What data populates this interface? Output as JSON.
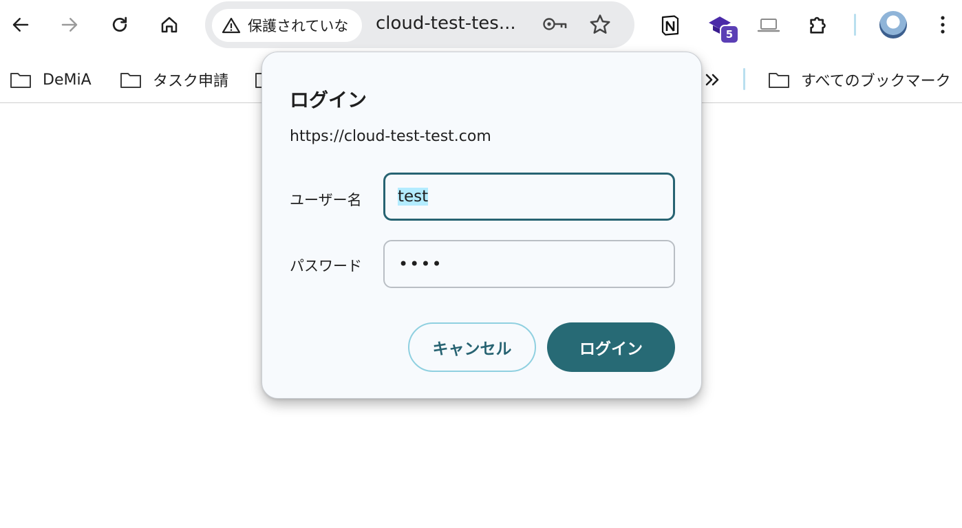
{
  "browser": {
    "security_chip": "保護されていな",
    "url": "cloud-test-tes...",
    "extension_badge": "5"
  },
  "bookmarks": [
    {
      "label": "DeMiA"
    },
    {
      "label": "タスク申請"
    }
  ],
  "all_bookmarks_label": "すべてのブックマーク",
  "dialog": {
    "title": "ログイン",
    "origin": "https://cloud-test-test.com",
    "username_label": "ユーザー名",
    "username_value": "test",
    "password_label": "パスワード",
    "password_value": "••••",
    "cancel_label": "キャンセル",
    "login_label": "ログイン"
  },
  "colors": {
    "accent": "#276a75",
    "focus_border": "#276372",
    "cancel_border": "#8fd0e0",
    "selection": "#b3ecff",
    "dialog_bg": "#f7fafd",
    "badge": "#5b3fb5"
  },
  "icons": [
    "back-icon",
    "forward-icon",
    "reload-icon",
    "home-icon",
    "warning-icon",
    "key-icon",
    "star-icon",
    "notion-icon",
    "graduation-cap-icon",
    "laptop-icon",
    "puzzle-icon",
    "avatar",
    "more-vert-icon",
    "folder-icon",
    "chevron-double-right-icon"
  ]
}
